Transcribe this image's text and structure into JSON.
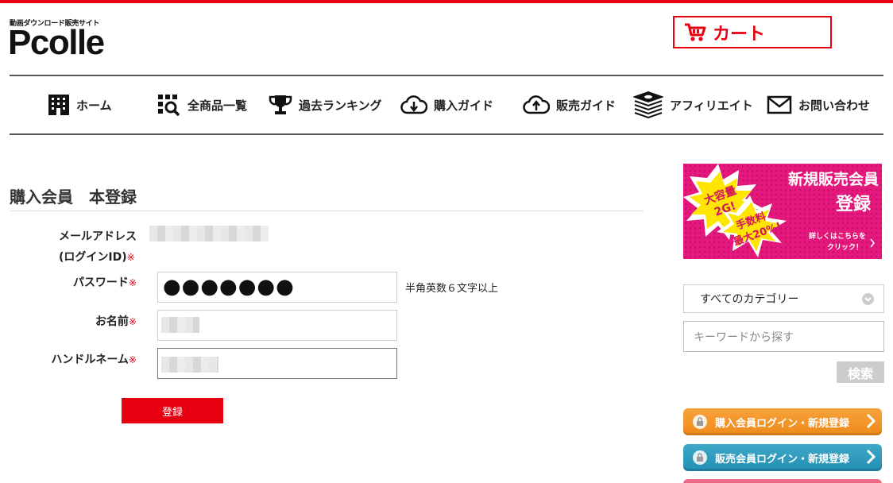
{
  "header": {
    "tagline": "動画ダウンロード販売サイト",
    "logo": "Pcolle",
    "cart_label": "カート"
  },
  "nav": {
    "items": [
      {
        "label": "ホーム",
        "icon": "building-icon"
      },
      {
        "label": "全商品一覧",
        "icon": "grid-search-icon"
      },
      {
        "label": "過去ランキング",
        "icon": "trophy-icon"
      },
      {
        "label": "購入ガイド",
        "icon": "cloud-download-icon"
      },
      {
        "label": "販売ガイド",
        "icon": "cloud-upload-icon"
      },
      {
        "label": "アフィリエイト",
        "icon": "money-stack-icon"
      },
      {
        "label": "お問い合わせ",
        "icon": "mail-icon"
      }
    ]
  },
  "main": {
    "heading": "購入会員　本登録",
    "form": {
      "email_label_1": "メールアドレス",
      "email_label_2": "(ログインID)",
      "password_label": "パスワード",
      "password_dots": "●●●●●●●",
      "password_hint": "半角英数６文字以上",
      "name_label": "お名前",
      "handle_label": "ハンドルネーム",
      "required_mark": "※",
      "submit_label": "登録"
    }
  },
  "sidebar": {
    "banner": {
      "title_1": "新規販売会員",
      "title_2": "登録",
      "burst_1_line1": "大容量",
      "burst_1_line2": "2G!",
      "burst_2_line1": "手数料",
      "burst_2_line2": "最大20%!",
      "link_1": "詳しくはこちらを",
      "link_2": "クリック！"
    },
    "category_select": "すべてのカテゴリー",
    "keyword_placeholder": "キーワードから探す",
    "search_label": "検索",
    "buyer_login_label": "購入会員ログイン・新規登録",
    "seller_login_label": "販売会員ログイン・新規登録",
    "colors": {
      "accent": "#e60012",
      "buyer_button": "#f09428",
      "seller_button": "#2f9cc0",
      "banner": "#e5197d"
    }
  }
}
